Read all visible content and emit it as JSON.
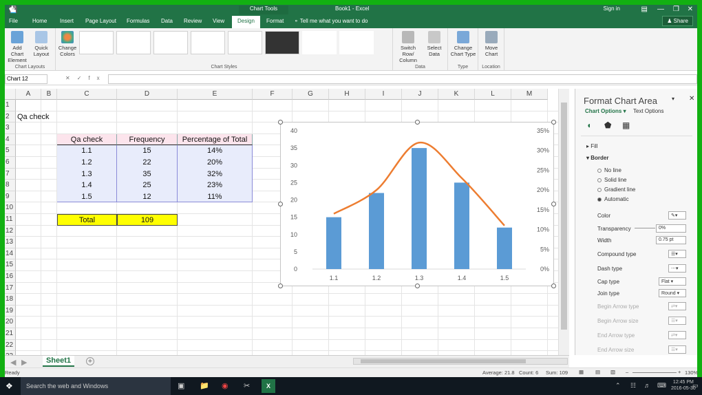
{
  "titlebar": {
    "context_tools": "Chart Tools",
    "title": "Book1 - Excel",
    "sign_in": "Sign in"
  },
  "tabs": [
    {
      "label": "File"
    },
    {
      "label": "Home"
    },
    {
      "label": "Insert"
    },
    {
      "label": "Page Layout"
    },
    {
      "label": "Formulas"
    },
    {
      "label": "Data"
    },
    {
      "label": "Review"
    },
    {
      "label": "View"
    },
    {
      "label": "Design"
    },
    {
      "label": "Format"
    }
  ],
  "tell_me": "Tell me what you want to do",
  "share": "Share",
  "ribbon": {
    "add_chart_element": "Add Chart Element",
    "quick_layout": "Quick Layout",
    "chart_layouts": "Chart Layouts",
    "change_colors": "Change Colors",
    "chart_styles": "Chart Styles",
    "switch_row_column": "Switch Row/ Column",
    "select_data": "Select Data",
    "data_group": "Data",
    "change_chart_type": "Change Chart Type",
    "type_group": "Type",
    "move_chart": "Move Chart",
    "location_group": "Location"
  },
  "formula_bar": {
    "name_box": "Chart 12",
    "fx": "fx",
    "content": ""
  },
  "columns": [
    "A",
    "B",
    "C",
    "D",
    "E",
    "F",
    "G",
    "H",
    "I",
    "J",
    "K",
    "L",
    "M"
  ],
  "rows": [
    "1",
    "2",
    "3",
    "4",
    "5",
    "6",
    "7",
    "8",
    "9",
    "10",
    "11",
    "12",
    "13",
    "14",
    "15",
    "16",
    "17",
    "18",
    "19",
    "20",
    "21",
    "22",
    "23"
  ],
  "sheet": {
    "a2": "Qa check",
    "table_headers": [
      "Qa check",
      "Frequency",
      "Percentage of Total"
    ],
    "table_rows": [
      [
        "1.1",
        "15",
        "14%"
      ],
      [
        "1.2",
        "22",
        "20%"
      ],
      [
        "1.3",
        "35",
        "32%"
      ],
      [
        "1.4",
        "25",
        "23%"
      ],
      [
        "1.5",
        "12",
        "11%"
      ]
    ],
    "total_label": "Total",
    "total_value": "109"
  },
  "chart_data": {
    "type": "bar",
    "categories": [
      "1.1",
      "1.2",
      "1.3",
      "1.4",
      "1.5"
    ],
    "series": [
      {
        "values": [
          15,
          22,
          35,
          25,
          12
        ],
        "color": "#5b9bd5",
        "axis": "primary",
        "kind": "bar"
      },
      {
        "values": [
          0.14,
          0.2,
          0.32,
          0.23,
          0.11
        ],
        "color": "#ed7d31",
        "axis": "secondary",
        "kind": "smooth-line"
      }
    ],
    "y_ticks": [
      "40",
      "35",
      "30",
      "25",
      "20",
      "15",
      "10",
      "5",
      "0"
    ],
    "y2_ticks": [
      "35%",
      "30%",
      "25%",
      "20%",
      "15%",
      "10%",
      "5%",
      "0%"
    ],
    "ylim": [
      0,
      40
    ],
    "y2lim": [
      0,
      0.35
    ],
    "grid": false,
    "title": "",
    "xlabel": "",
    "ylabel": ""
  },
  "pane": {
    "title": "Format Chart Area",
    "chart_options": "Chart Options",
    "text_options": "Text Options",
    "fill": "Fill",
    "border": "Border",
    "no_line": "No line",
    "solid_line": "Solid line",
    "gradient_line": "Gradient line",
    "automatic": "Automatic",
    "color": "Color",
    "transparency": "Transparency",
    "transparency_value": "0%",
    "width": "Width",
    "width_value": "0.75 pt",
    "compound_type": "Compound type",
    "dash_type": "Dash type",
    "cap_type": "Cap type",
    "cap_value": "Flat",
    "join_type": "Join type",
    "join_value": "Round",
    "begin_arrow_type": "Begin Arrow type",
    "begin_arrow_size": "Begin Arrow size",
    "end_arrow_type": "End Arrow type",
    "end_arrow_size": "End Arrow size"
  },
  "sheet_tab": "Sheet1",
  "status": {
    "ready": "Ready",
    "average": "Average: 21.8",
    "count": "Count: 6",
    "sum": "Sum: 109",
    "zoom": "130%"
  },
  "taskbar": {
    "search": "Search the web and Windows",
    "time": "12:45 PM",
    "date": "2016-05-30"
  }
}
